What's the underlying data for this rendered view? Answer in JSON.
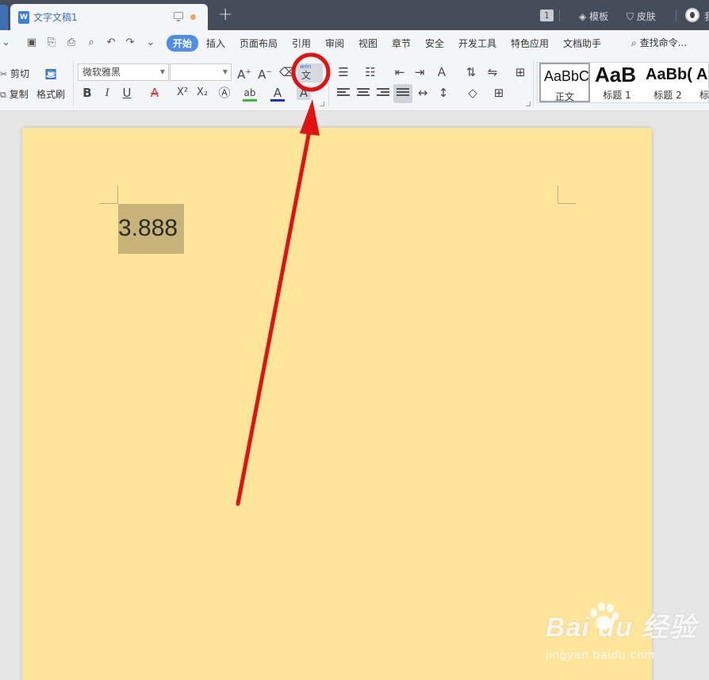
{
  "titlebar": {
    "doc_icon": "W",
    "doc_title": "文字文稿1",
    "add_tab": "+",
    "badge": "1",
    "template_label": "模板",
    "skin_label": "皮肤",
    "user_initial": "我"
  },
  "menu": {
    "tabs": [
      "开始",
      "插入",
      "页面布局",
      "引用",
      "审阅",
      "视图",
      "章节",
      "安全",
      "开发工具",
      "特色应用",
      "文档助手"
    ],
    "search_label": "查找命令..."
  },
  "toolbar": {
    "cut_label": "剪切",
    "copy_label": "复制",
    "format_painter_label": "格式刷",
    "font_name": "微软雅黑",
    "font_size": "",
    "bold": "B",
    "italic": "I",
    "underline": "U",
    "strike": "A",
    "superscript": "X²",
    "subscript": "X₂",
    "phonetic_top": "wén",
    "phonetic_char": "文",
    "grow_font": "A",
    "shrink_font": "A",
    "styles": [
      {
        "preview": "AaBbCcDd",
        "label": "正文"
      },
      {
        "preview": "AaB",
        "label": "标题 1"
      },
      {
        "preview": "AaBb(",
        "label": "标题 2"
      },
      {
        "preview": "A",
        "label": "标"
      }
    ]
  },
  "document": {
    "selected_text": "3.888"
  },
  "watermark": {
    "main": "Bai  du 经验",
    "sub": "jingyan.baidu.com"
  },
  "colors": {
    "accent": "#4f8ee6",
    "page": "#fee599",
    "selection": "#c9b378",
    "annotation": "#e11212"
  }
}
